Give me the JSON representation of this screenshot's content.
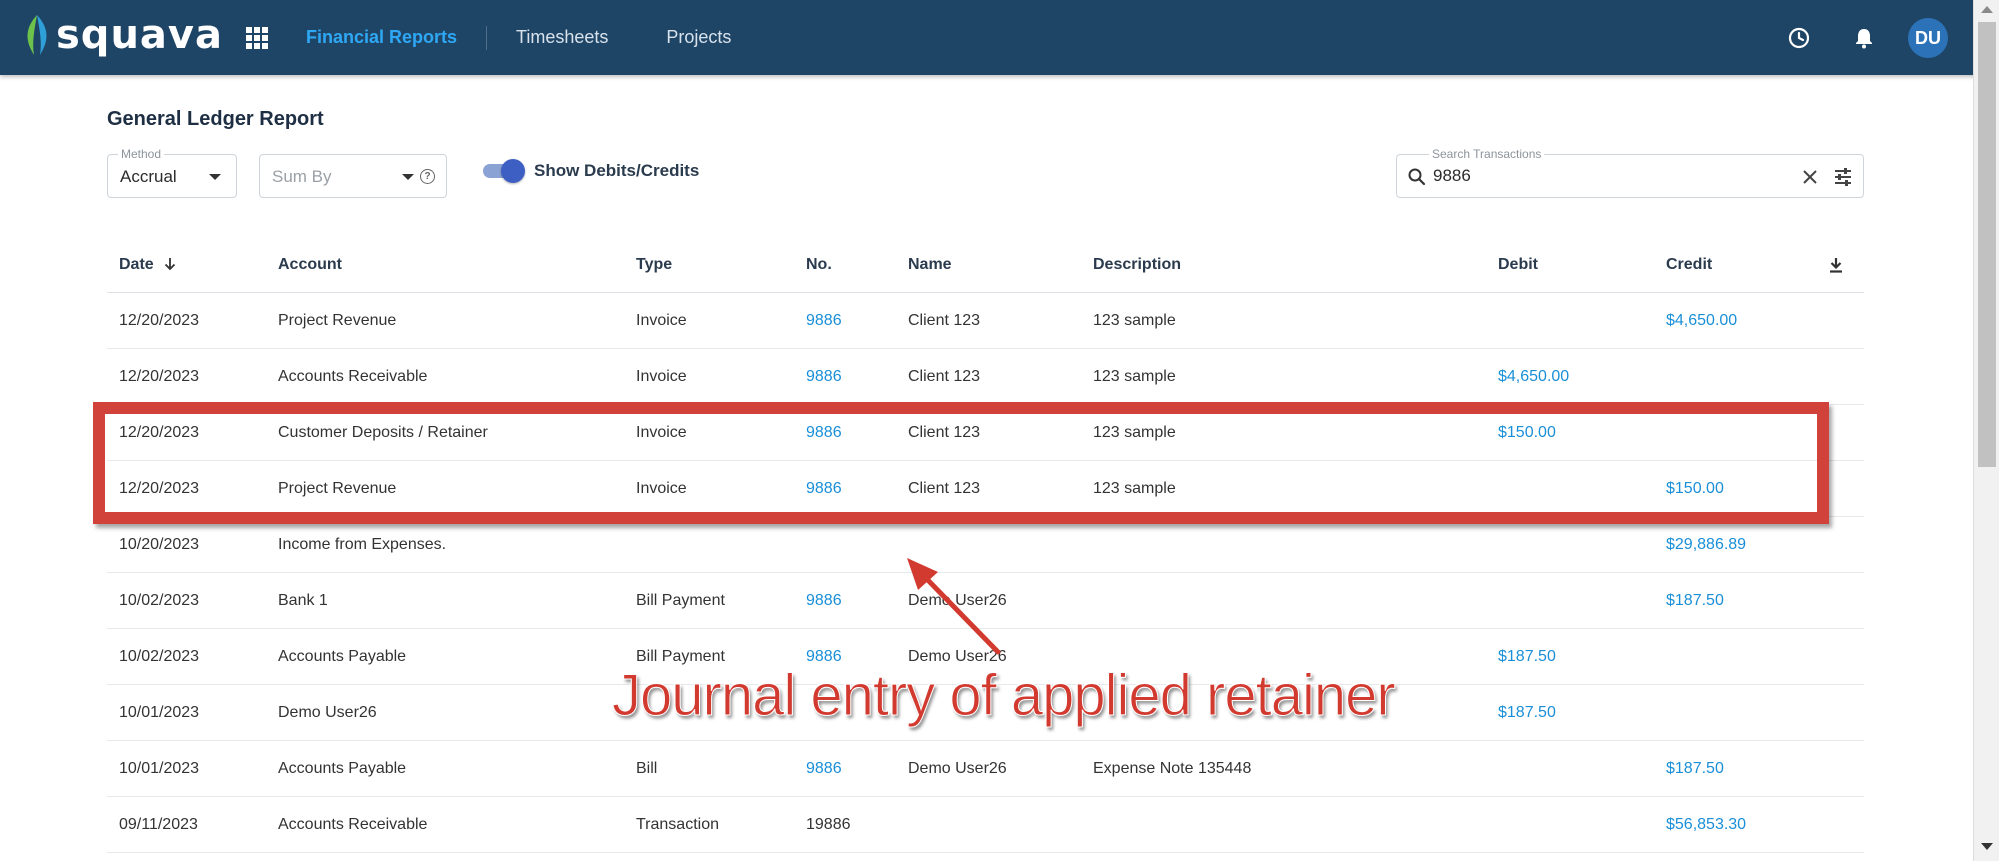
{
  "app": {
    "logo_text": "squava",
    "nav": [
      {
        "label": "Financial Reports",
        "active": true
      },
      {
        "label": "Timesheets",
        "active": false
      },
      {
        "label": "Projects",
        "active": false
      }
    ],
    "icons": [
      "apps-grid-icon",
      "clock-icon",
      "bell-icon"
    ],
    "avatar_initials": "DU",
    "colors": {
      "header_bg": "#1f4566",
      "accent": "#2ea8f5",
      "link": "#1a8fd8",
      "annotation": "#d0423a"
    }
  },
  "page": {
    "title": "General Ledger Report"
  },
  "filters": {
    "method": {
      "label": "Method",
      "value": "Accrual"
    },
    "sum_by": {
      "placeholder": "Sum By"
    },
    "toggle": {
      "label": "Show Debits/Credits",
      "on": true
    },
    "search": {
      "label": "Search Transactions",
      "value": "9886"
    }
  },
  "table": {
    "headers": {
      "date": "Date",
      "account": "Account",
      "type": "Type",
      "no": "No.",
      "name": "Name",
      "description": "Description",
      "debit": "Debit",
      "credit": "Credit"
    },
    "rows": [
      {
        "date": "12/20/2023",
        "account": "Project Revenue",
        "type": "Invoice",
        "no": "9886",
        "name": "Client 123",
        "description": "123 sample",
        "debit": "",
        "credit": "$4,650.00"
      },
      {
        "date": "12/20/2023",
        "account": "Accounts Receivable",
        "type": "Invoice",
        "no": "9886",
        "name": "Client 123",
        "description": "123 sample",
        "debit": "$4,650.00",
        "credit": ""
      },
      {
        "date": "12/20/2023",
        "account": "Customer Deposits / Retainer",
        "type": "Invoice",
        "no": "9886",
        "name": "Client 123",
        "description": "123 sample",
        "debit": "$150.00",
        "credit": ""
      },
      {
        "date": "12/20/2023",
        "account": "Project Revenue",
        "type": "Invoice",
        "no": "9886",
        "name": "Client 123",
        "description": "123 sample",
        "debit": "",
        "credit": "$150.00"
      },
      {
        "date": "10/20/2023",
        "account": "Income from Expenses.",
        "type": "",
        "no": "",
        "name": "",
        "description": "",
        "debit": "",
        "credit": "$29,886.89"
      },
      {
        "date": "10/02/2023",
        "account": "Bank 1",
        "type": "Bill Payment",
        "no": "9886",
        "name": "Demo User26",
        "description": "",
        "debit": "",
        "credit": "$187.50"
      },
      {
        "date": "10/02/2023",
        "account": "Accounts Payable",
        "type": "Bill Payment",
        "no": "9886",
        "name": "Demo User26",
        "description": "",
        "debit": "$187.50",
        "credit": ""
      },
      {
        "date": "10/01/2023",
        "account": "Demo User26",
        "type": "",
        "no": "",
        "name": "",
        "description": "",
        "debit": "$187.50",
        "credit": ""
      },
      {
        "date": "10/01/2023",
        "account": "Accounts Payable",
        "type": "Bill",
        "no": "9886",
        "name": "Demo User26",
        "description": "Expense Note 135448",
        "debit": "",
        "credit": "$187.50"
      },
      {
        "date": "09/11/2023",
        "account": "Accounts Receivable",
        "type": "Transaction",
        "no": "19886",
        "name": "",
        "description": "",
        "debit": "",
        "credit": "$56,853.30"
      }
    ]
  },
  "annotation": {
    "text": "Journal entry of applied retainer"
  }
}
